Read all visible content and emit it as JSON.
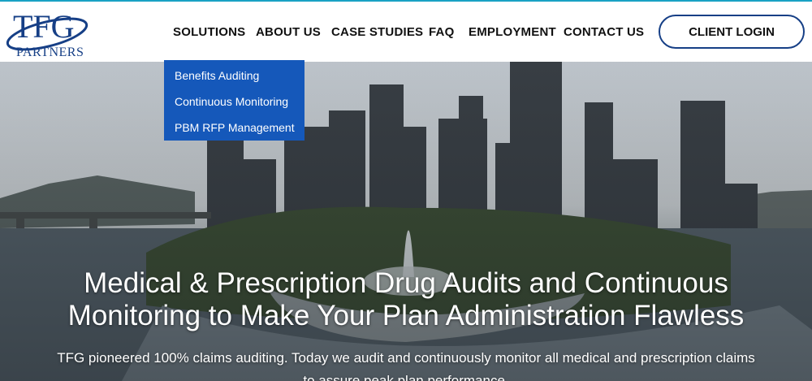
{
  "brand": {
    "logo_letters": "TFG",
    "logo_word": "PARTNERS"
  },
  "nav": {
    "items": [
      {
        "label": "SOLUTIONS"
      },
      {
        "label": "ABOUT US"
      },
      {
        "label": "CASE STUDIES"
      },
      {
        "label": "FAQ"
      },
      {
        "label": "EMPLOYMENT"
      },
      {
        "label": "CONTACT US"
      }
    ],
    "login_label": "CLIENT LOGIN"
  },
  "dropdown": {
    "items": [
      {
        "label": "Benefits Auditing"
      },
      {
        "label": "Continuous Monitoring"
      },
      {
        "label": "PBM RFP Management"
      }
    ]
  },
  "hero": {
    "headline_line1": "Medical & Prescription Drug Audits and Continuous",
    "headline_line2": "Monitoring to Make Your Plan Administration Flawless",
    "subtext_line1": "TFG pioneered 100% claims auditing. Today we audit and continuously monitor all medical and prescription claims",
    "subtext_line2": "to assure peak plan performance."
  },
  "colors": {
    "accent": "#19a2c4",
    "brand_navy": "#163f86",
    "dropdown_bg": "#1558ba"
  }
}
